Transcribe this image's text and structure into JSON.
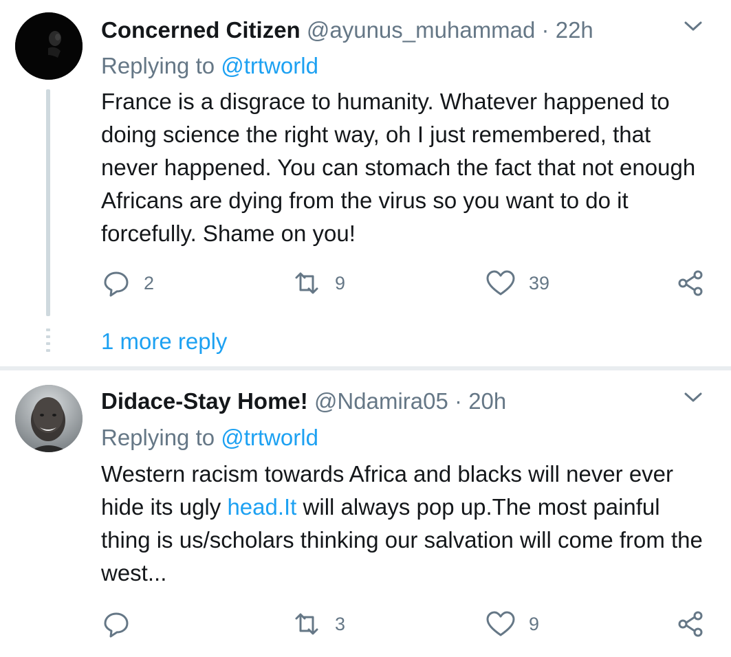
{
  "tweets": [
    {
      "author_name": "Concerned Citizen",
      "handle": "@ayunus_muhammad",
      "separator": "·",
      "time": "22h",
      "replying_prefix": "Replying to ",
      "replying_to": "@trtworld",
      "text": "France is a disgrace to humanity. Whatever happened to doing science the right way, oh I just remembered, that never happened. You can stomach the fact that not enough Africans are dying from the virus so you want to do it forcefully. Shame on you!",
      "reply_count": "2",
      "retweet_count": "9",
      "like_count": "39",
      "more_replies": "1 more reply"
    },
    {
      "author_name": "Didace-Stay Home!",
      "handle": "@Ndamira05",
      "separator": "·",
      "time": "20h",
      "replying_prefix": "Replying to ",
      "replying_to": "@trtworld",
      "text_before_link": "Western racism towards Africa and blacks will never ever hide its ugly ",
      "text_link": "head.It",
      "text_after_link": " will always pop up.The most painful thing is us/scholars thinking our salvation will come from the west...",
      "reply_count": "",
      "retweet_count": "3",
      "like_count": "9"
    }
  ],
  "icons": {
    "reply": "speech-bubble-icon",
    "retweet": "retweet-arrows-icon",
    "like": "heart-icon",
    "share": "share-nodes-icon",
    "menu": "chevron-down-icon"
  },
  "colors": {
    "text": "#14171a",
    "secondary": "#657786",
    "accent": "#1da1f2",
    "separator": "#e9edf0",
    "thread_line": "#cfd9de"
  }
}
